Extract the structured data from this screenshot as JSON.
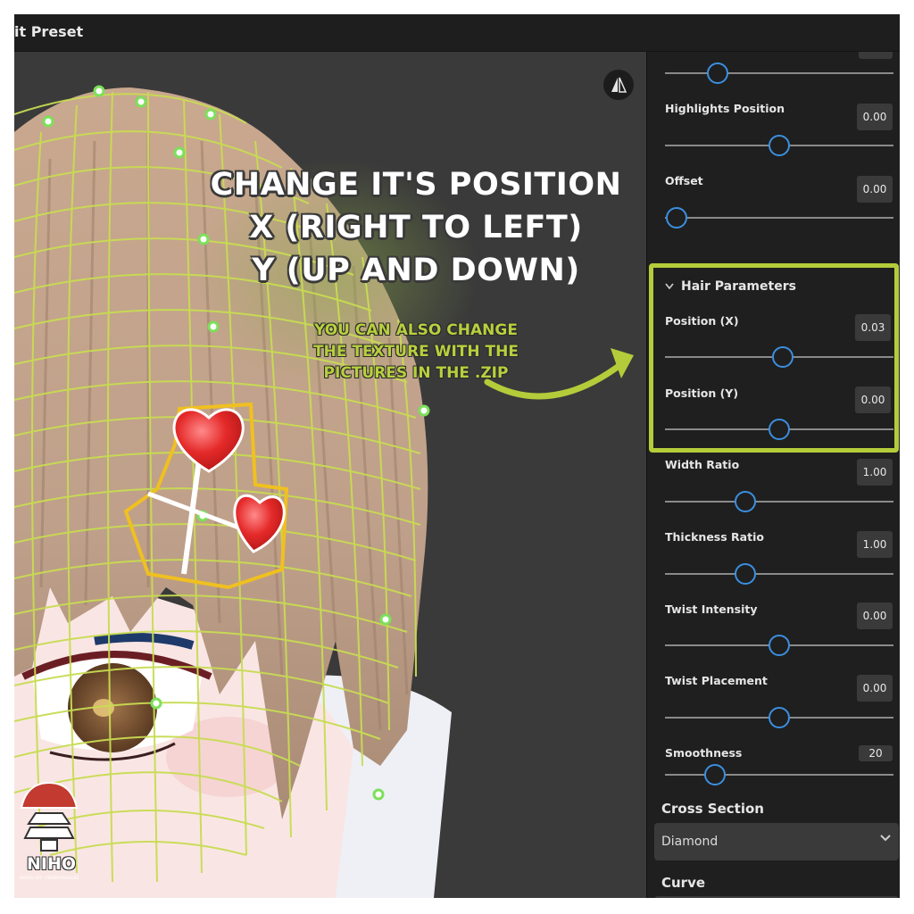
{
  "window": {
    "title": "it Preset"
  },
  "annotation": {
    "headline": [
      "CHANGE IT'S POSITION",
      "X (RIGHT TO LEFT)",
      "Y (UP AND DOWN)"
    ],
    "subtext": [
      "YOU CAN ALSO CHANGE",
      "THE TEXTURE WITH THE",
      "PICTURES IN THE .ZIP"
    ],
    "highlight_color": "#b4cc3a"
  },
  "panel": {
    "top_slider": {
      "level": 0.23
    },
    "highlights_position": {
      "label": "Highlights Position",
      "value": "0.00",
      "level": 0.5
    },
    "offset": {
      "label": "Offset",
      "value": "0.00",
      "level": 0.05
    },
    "hair_parameters": {
      "title": "Hair Parameters",
      "position_x": {
        "label": "Position (X)",
        "value": "0.03",
        "level": 0.515
      },
      "position_y": {
        "label": "Position (Y)",
        "value": "0.00",
        "level": 0.5
      }
    },
    "width_ratio": {
      "label": "Width Ratio",
      "value": "1.00",
      "level": 0.35
    },
    "thickness_ratio": {
      "label": "Thickness Ratio",
      "value": "1.00",
      "level": 0.35
    },
    "twist_intensity": {
      "label": "Twist Intensity",
      "value": "0.00",
      "level": 0.5
    },
    "twist_placement": {
      "label": "Twist Placement",
      "value": "0.00",
      "level": 0.5
    },
    "smoothness": {
      "label": "Smoothness",
      "value": "20",
      "level": 0.22
    },
    "cross_section": {
      "label": "Cross Section",
      "selected": "Diamond"
    },
    "curve": {
      "label": "Curve"
    }
  },
  "logo": {
    "name": "NIHO",
    "tagline": "DIGITAL ART · FREEBIE MODELER"
  },
  "colors": {
    "accent": "#3b8fe0",
    "panel_bg": "#1f1f1f",
    "viewport_bg": "#3a3a3a"
  },
  "icons": {
    "view_toggle": "perspective-icon",
    "dropdown": "chevron-down-icon",
    "section": "chevron-down-icon"
  }
}
